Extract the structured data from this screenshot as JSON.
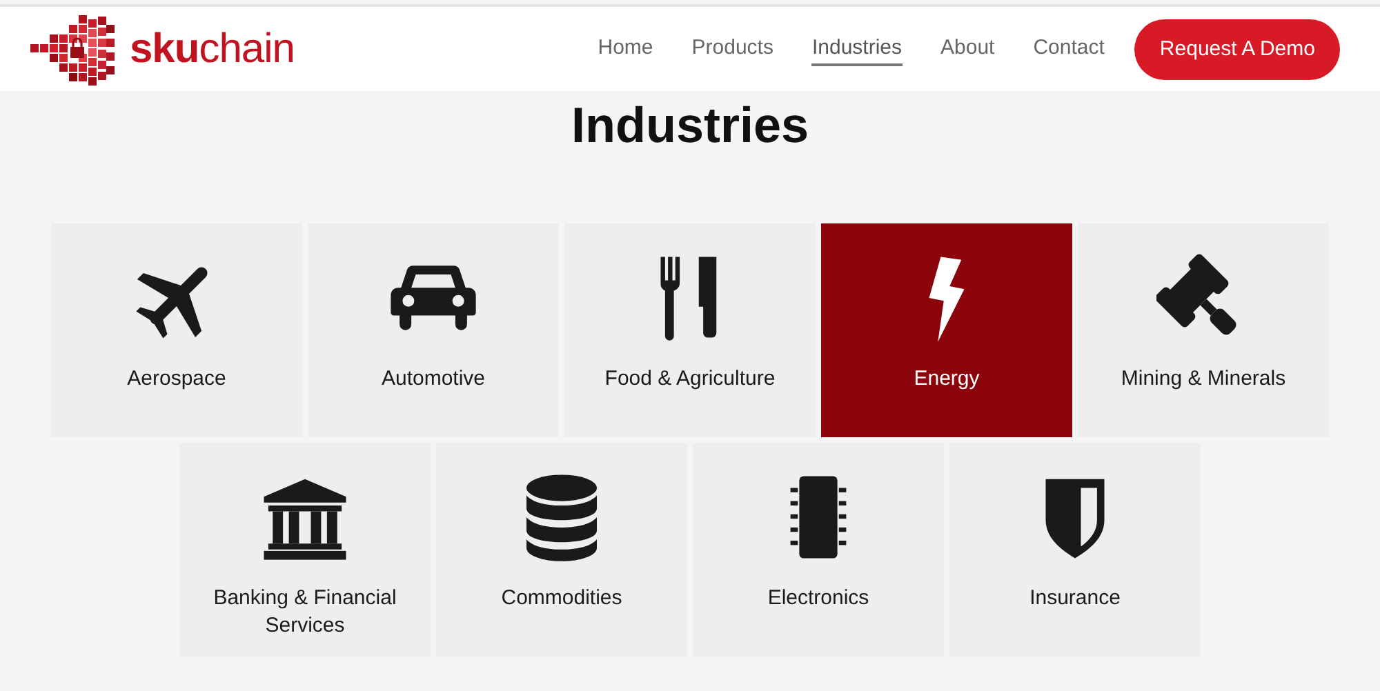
{
  "header": {
    "logo_text": "**sku**chain",
    "nav": [
      {
        "label": "Home",
        "selected": false
      },
      {
        "label": "Products",
        "selected": false
      },
      {
        "label": "Industries",
        "selected": true
      },
      {
        "label": "About",
        "selected": false
      },
      {
        "label": "Contact",
        "selected": false
      }
    ],
    "cta_button": "Request A Demo"
  },
  "heading": "Industries",
  "tiles": [
    {
      "label": "Aerospace",
      "selected": false
    },
    {
      "label": "Automotive",
      "selected": false
    },
    {
      "label": "Food & Agriculture",
      "selected": false
    },
    {
      "label": "Energy",
      "selected": true
    },
    {
      "label": "Mining & Minerals",
      "selected": false
    },
    {
      "label": "Banking & Financial Services",
      "selected": false
    },
    {
      "label": "Commodities",
      "selected": false
    },
    {
      "label": "Electronics",
      "selected": false
    },
    {
      "label": "Insurance",
      "selected": false
    }
  ]
}
